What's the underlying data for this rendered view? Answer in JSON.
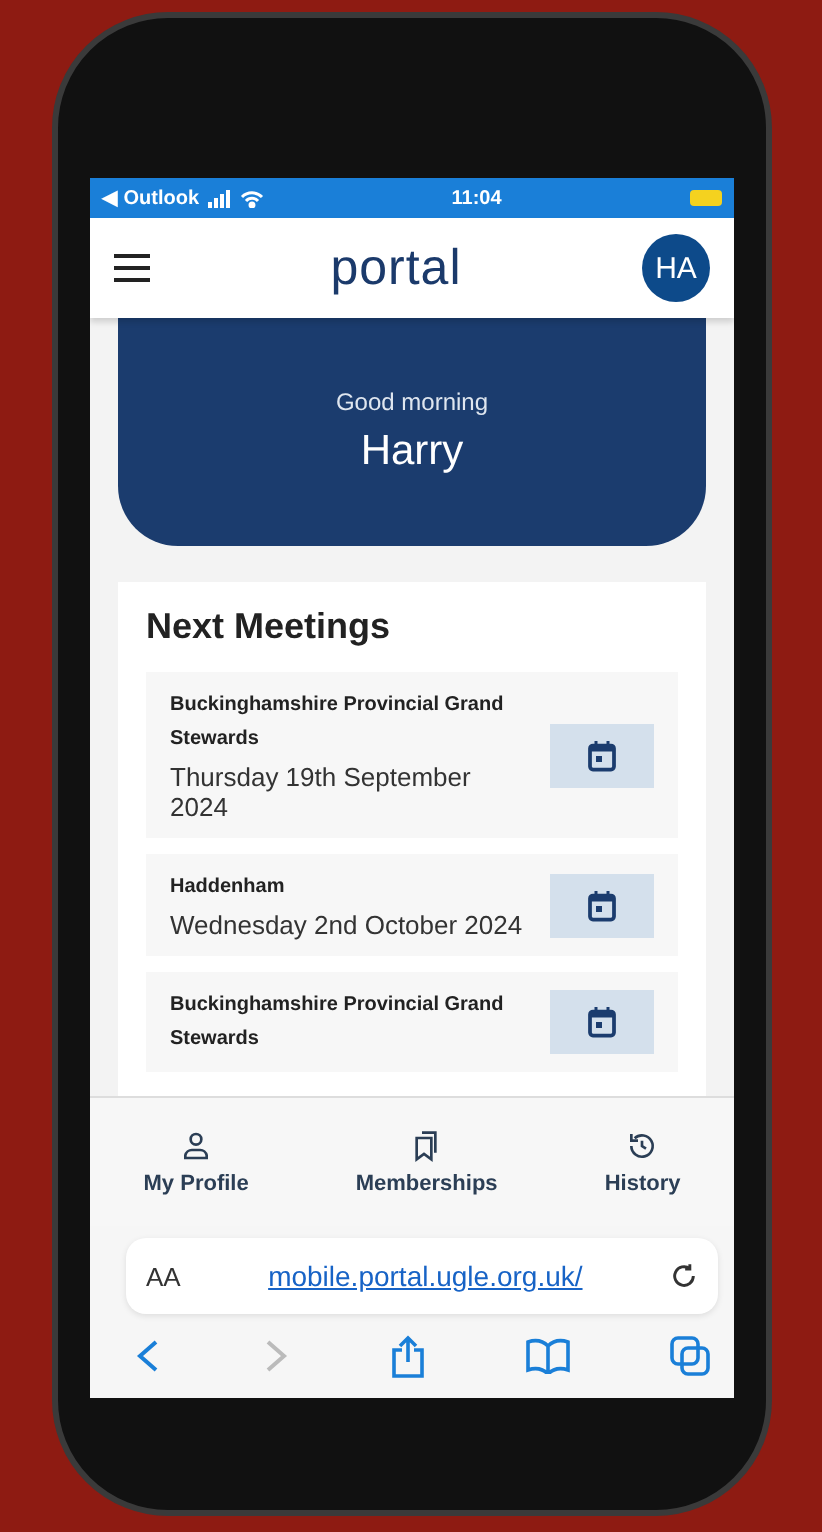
{
  "status_bar": {
    "back_app": "◀ Outlook",
    "time": "11:04"
  },
  "header": {
    "logo": "portal",
    "avatar": "HA"
  },
  "banner": {
    "greeting": "Good morning",
    "name": "Harry"
  },
  "next_meetings": {
    "title": "Next Meetings",
    "items": [
      {
        "name": "Buckinghamshire Provincial Grand Stewards",
        "date": "Thursday 19th September 2024"
      },
      {
        "name": "Haddenham",
        "date": "Wednesday 2nd October 2024"
      },
      {
        "name": "Buckinghamshire Provincial Grand Stewards"
      }
    ]
  },
  "bottom_nav": [
    {
      "kind": "profile",
      "label": "My Profile"
    },
    {
      "kind": "memberships",
      "label": "Memberships"
    },
    {
      "kind": "history",
      "label": "History"
    }
  ],
  "browser": {
    "text_size": "AA",
    "url": "mobile.portal.ugle.org.uk/"
  }
}
